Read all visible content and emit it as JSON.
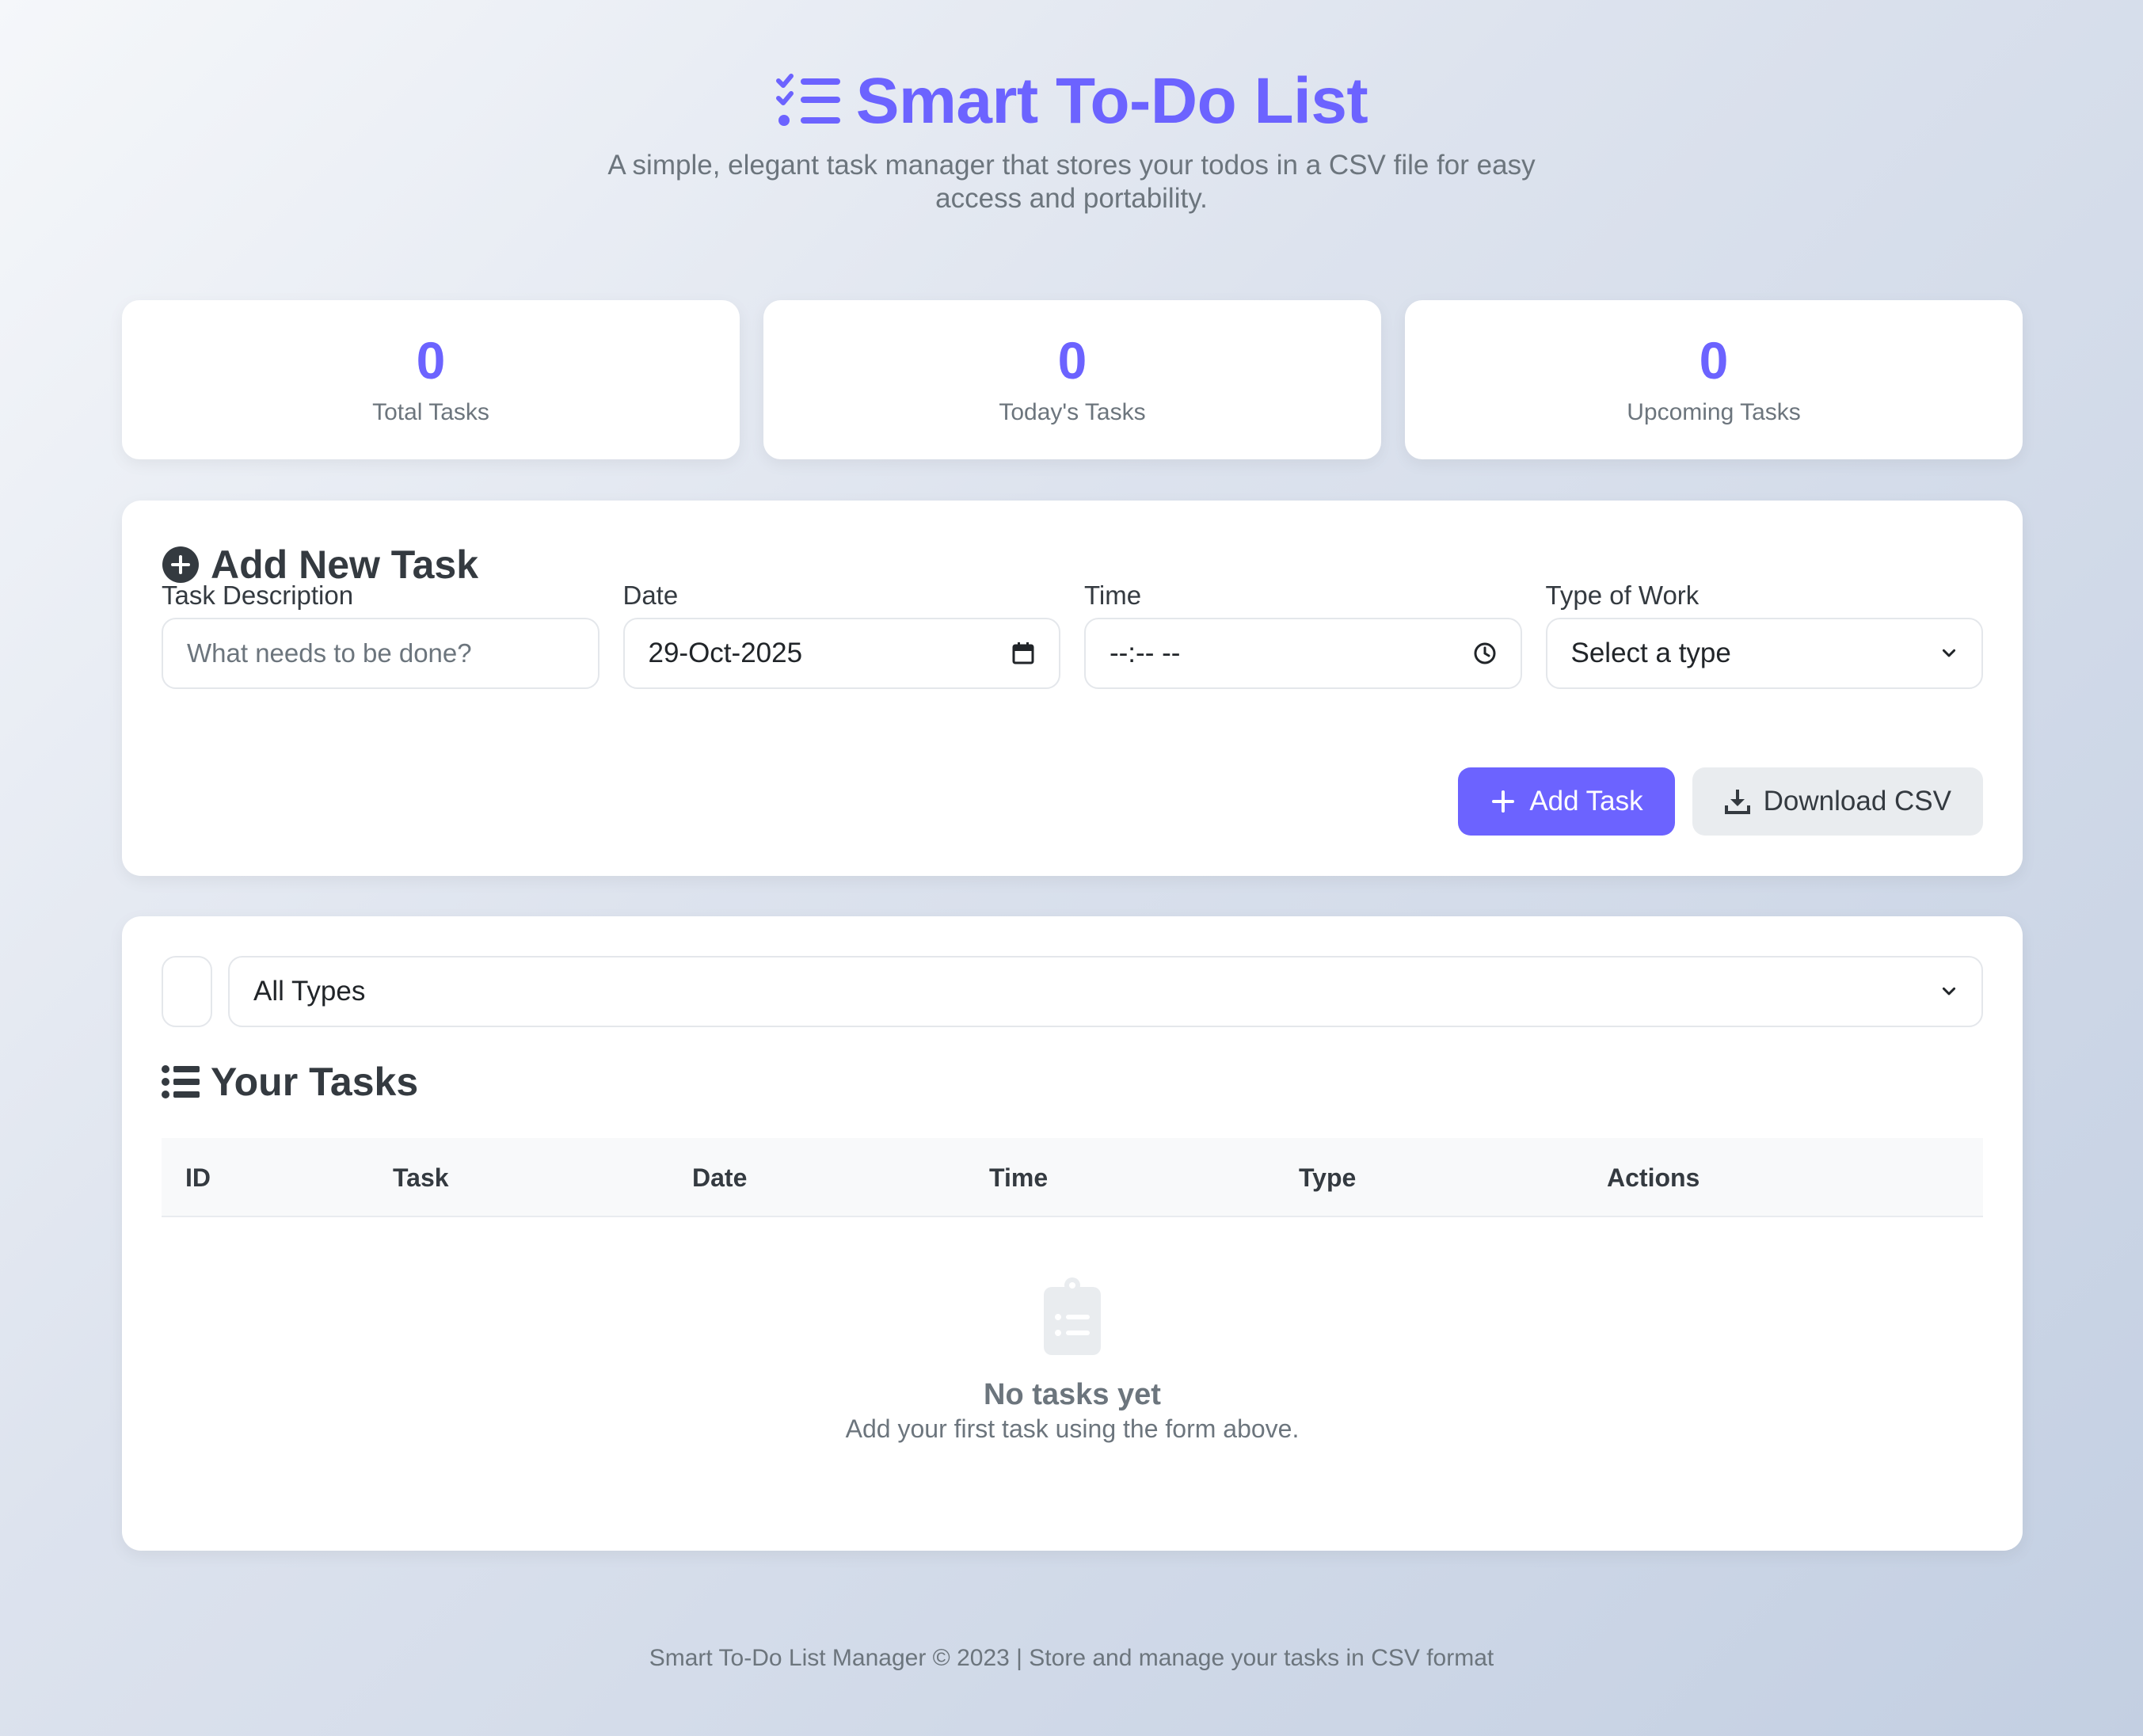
{
  "header": {
    "title": "Smart To-Do List",
    "subtitle": "A simple, elegant task manager that stores your todos in a CSV file for easy access and portability."
  },
  "stats": [
    {
      "value": "0",
      "label": "Total Tasks"
    },
    {
      "value": "0",
      "label": "Today's Tasks"
    },
    {
      "value": "0",
      "label": "Upcoming Tasks"
    }
  ],
  "form": {
    "title": "Add New Task",
    "description_label": "Task Description",
    "description_placeholder": "What needs to be done?",
    "date_label": "Date",
    "date_value": "29-Oct-2025",
    "time_label": "Time",
    "time_value": "--:-- --",
    "type_label": "Type of Work",
    "type_value": "Select a type",
    "add_button": "Add Task",
    "download_button": "Download CSV"
  },
  "tasks": {
    "filter_value": "All Types",
    "title": "Your Tasks",
    "columns": [
      "ID",
      "Task",
      "Date",
      "Time",
      "Type",
      "Actions"
    ],
    "empty_title": "No tasks yet",
    "empty_text": "Add your first task using the form above."
  },
  "footer": {
    "text": "Smart To-Do List Manager © 2023 | Store and manage your tasks in CSV format"
  },
  "colors": {
    "accent": "#6c63ff",
    "text": "#343a40",
    "muted": "#6c757d"
  }
}
